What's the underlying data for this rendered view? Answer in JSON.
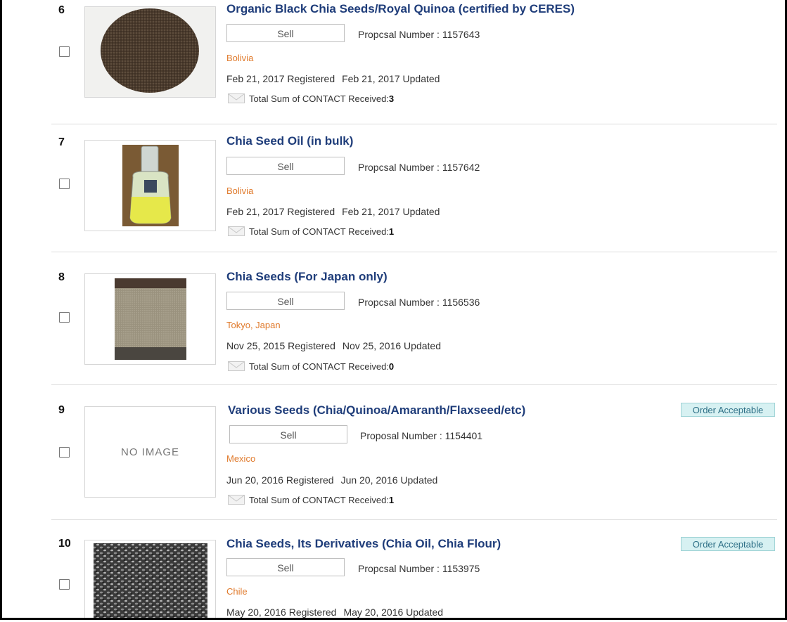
{
  "listings": [
    {
      "number": "6",
      "title": "Organic Black Chia Seeds/Royal Quinoa (certified by CERES)",
      "sell_label": "Sell",
      "proposal_label": "Propcsal Number : ",
      "proposal_number": "1157643",
      "location": "Bolivia",
      "registered": "Feb 21, 2017 Registered",
      "updated": "Feb 21, 2017 Updated",
      "contact_label": "Total Sum of CONTACT Received:",
      "contact_count": "3",
      "image": "black-chia-seeds-image"
    },
    {
      "number": "7",
      "title": "Chia Seed Oil (in bulk)",
      "sell_label": "Sell",
      "proposal_label": "Propcsal Number : ",
      "proposal_number": "1157642",
      "location": "Bolivia",
      "registered": "Feb 21, 2017 Registered",
      "updated": "Feb 21, 2017 Updated",
      "contact_label": "Total Sum of CONTACT Received:",
      "contact_count": "1",
      "image": "chia-oil-bottle-image"
    },
    {
      "number": "8",
      "title": "Chia Seeds (For Japan only)",
      "sell_label": "Sell",
      "proposal_label": "Propcsal Number : ",
      "proposal_number": "1156536",
      "location": "Tokyo, Japan",
      "registered": "Nov 25, 2015 Registered",
      "updated": "Nov 25, 2016 Updated",
      "contact_label": "Total Sum of CONTACT Received:",
      "contact_count": "0",
      "image": "chia-seeds-tray-image"
    },
    {
      "number": "9",
      "title": "Various Seeds (Chia/Quinoa/Amaranth/Flaxseed/etc)",
      "badge": "Order Acceptable",
      "sell_label": "Sell",
      "proposal_label": "Proposal Number : ",
      "proposal_number": "1154401",
      "location": "Mexico",
      "registered": "Jun 20, 2016 Registered",
      "updated": "Jun 20, 2016 Updated",
      "contact_label": "Total Sum of CONTACT Received:",
      "contact_count": "1",
      "no_image_text": "NO IMAGE"
    },
    {
      "number": "10",
      "title": "Chia Seeds, Its Derivatives (Chia Oil, Chia Flour)",
      "badge": "Order Acceptable",
      "sell_label": "Sell",
      "proposal_label": "Propcsal Number : ",
      "proposal_number": "1153975",
      "location": "Chile",
      "registered": "May 20, 2016 Registered",
      "updated": "May 20, 2016 Updated",
      "image": "chia-seeds-closeup-image"
    }
  ],
  "colors": {
    "title": "#1f3d7a",
    "location": "#e07a2c",
    "badge_bg": "#d7f1f2",
    "badge_text": "#2d6f86"
  }
}
